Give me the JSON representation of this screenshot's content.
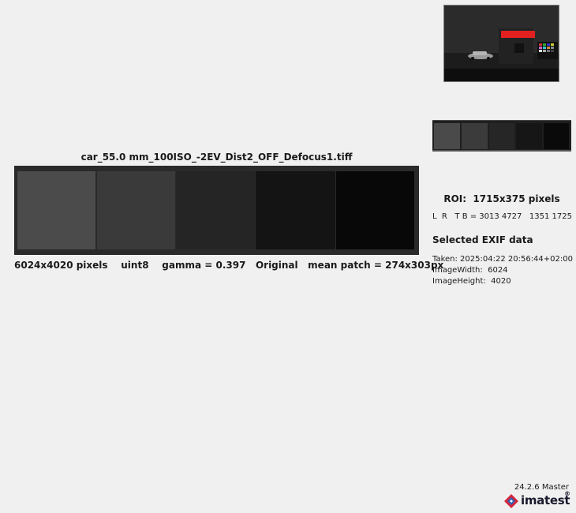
{
  "main": {
    "file_title": "car_55.0 mm_100ISO_-2EV_Dist2_OFF_Defocus1.tiff",
    "info_line": "6024x4020 pixels    uint8    gamma = 0.397   Original   mean patch = 274x303px",
    "patch_colors": [
      "#4b4b4b",
      "#3a3a3a",
      "#252525",
      "#141414",
      "#080808"
    ]
  },
  "thumbnail": {
    "background": "#222222",
    "highlight_color": "#e22020"
  },
  "small_strip": {
    "patch_colors": [
      "#4a4a4a",
      "#3b3b3b",
      "#262626",
      "#161616",
      "#0a0a0a"
    ]
  },
  "roi": {
    "title": "ROI:  1715x375 pixels",
    "coords": "L  R   T B = 3013 4727   1351 1725"
  },
  "exif": {
    "heading": "Selected EXIF data",
    "taken": "Taken: 2025:04:22 20:56:44+02:00",
    "width": "ImageWidth:  6024",
    "height": "ImageHeight:  4020"
  },
  "footer": {
    "version": "24.2.6 Master",
    "logo_text": "imatest",
    "logo_reg": "®",
    "logo_colors": [
      "#d6263a",
      "#2f5fb3"
    ]
  }
}
